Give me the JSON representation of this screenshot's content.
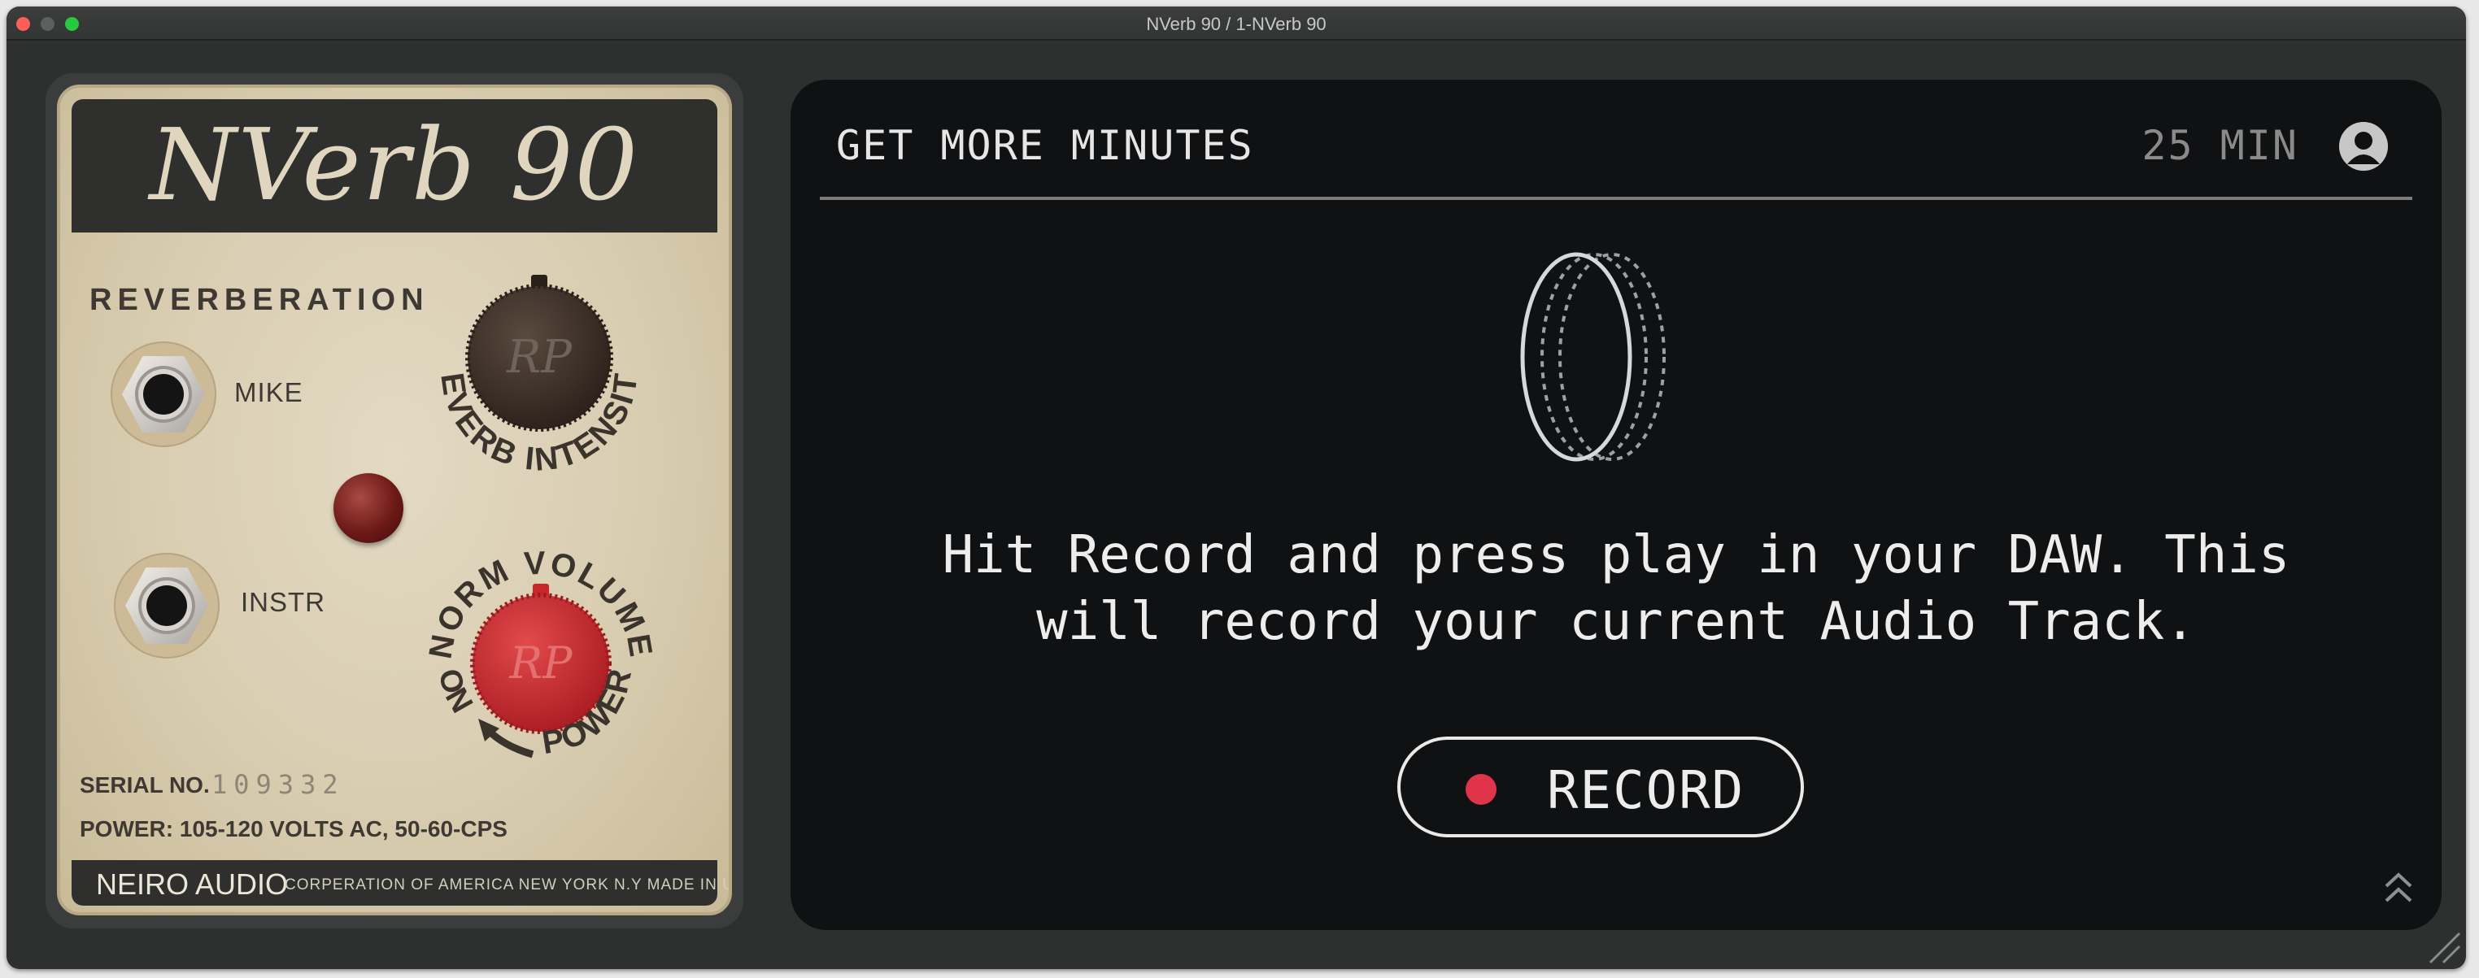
{
  "window": {
    "title": "NVerb 90 / 1-NVerb 90"
  },
  "amp_panel": {
    "logo_text": "NVerb 90",
    "section_title": "REVERBERATION",
    "jacks": [
      {
        "label": "MIKE"
      },
      {
        "label": "INSTR"
      }
    ],
    "knobs": {
      "intensity_label": "REVERB INTENSITY",
      "volume_label": "NORM VOLUME",
      "power_label": "POWER",
      "on_label": "ON",
      "knob_monogram": "RP"
    },
    "serial_label": "SERIAL NO.",
    "serial_number": "109332",
    "power_spec": "POWER: 105-120 VOLTS AC, 50-60-CPS",
    "brand": "NEIRO AUDIO",
    "footer_text": "CORPERATION OF AMERICA    NEW YORK    N.Y    MADE IN U.S.A"
  },
  "main_panel": {
    "header_link": "GET MORE MINUTES",
    "minutes_remaining": "25 MIN",
    "instructions": "Hit Record and press play in your DAW. This\nwill record your current Audio Track.",
    "record_button_label": "RECORD"
  },
  "colors": {
    "record_dot": "#e0344b",
    "panel_bg": "#101112",
    "amp_face": "#d8ccb0",
    "amp_dark": "#2f2f2e",
    "volume_knob": "#c8262b",
    "intensity_knob": "#3a2e26"
  },
  "icons": {
    "window_close": "close-dot",
    "window_minimize": "minimize-dot",
    "window_maximize": "maximize-dot",
    "user": "user-icon",
    "loop_rings": "audio-rings-icon",
    "collapse": "chevron-double-up-icon",
    "resize": "resize-grip-icon"
  }
}
